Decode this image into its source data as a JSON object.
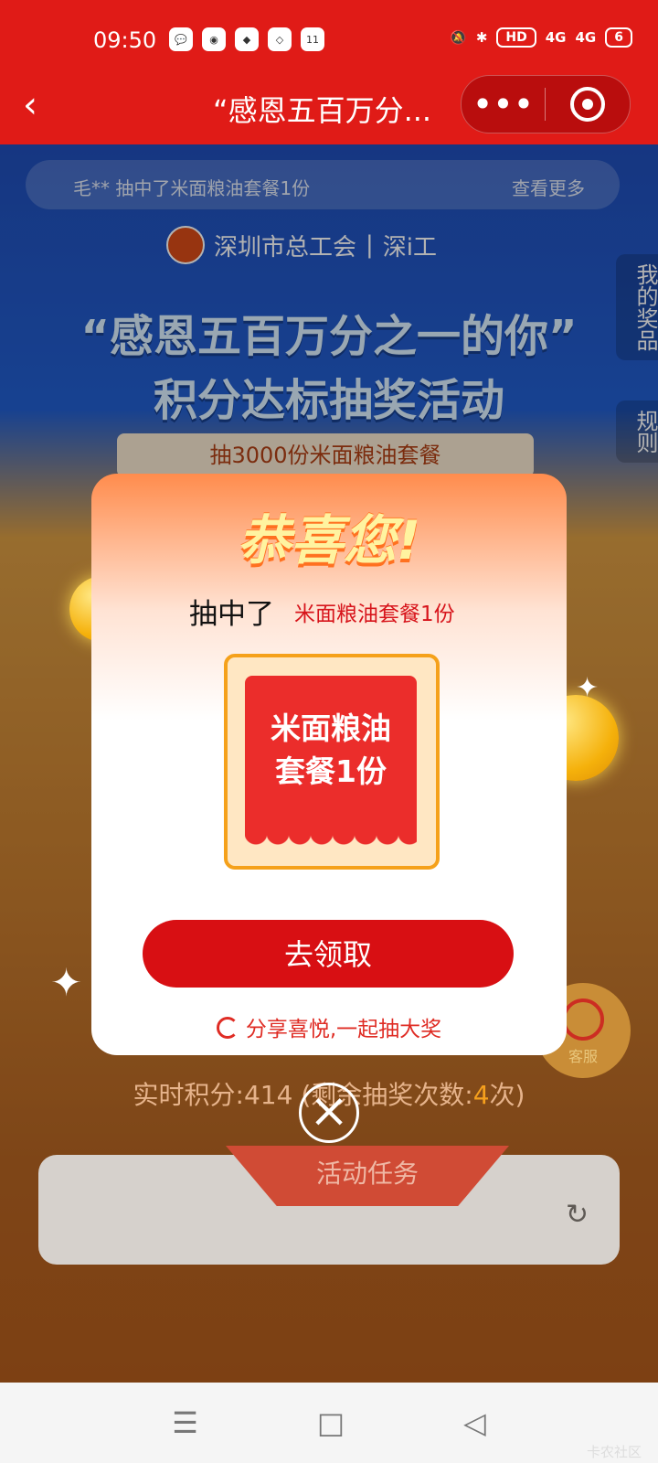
{
  "status": {
    "time": "09:50",
    "apps": [
      "💬",
      "◉",
      "◆",
      "◇",
      "11"
    ],
    "network": [
      "HD",
      "4G",
      "4G",
      "6"
    ]
  },
  "navbar": {
    "title": "“感恩五百万分...",
    "back_icon": "back-chevron",
    "more_icon": "more-dots",
    "target_icon": "target-circle"
  },
  "background": {
    "winner_text": "毛** 抽中了米面粮油套餐1份",
    "winner_more": "查看更多",
    "org_left": "深圳市总工会",
    "org_right": "深i工",
    "headline_1": "“感恩五百万分之一的你”",
    "headline_2": "积分达标抽奖活动",
    "prize_bar": "抽3000份米面粮油套餐",
    "side_tabs": [
      "我的奖品",
      "规则"
    ],
    "score_prefix": "实时积分:414 (剩余抽奖次数:",
    "score_count": "4",
    "score_suffix": "次)",
    "service": "客服",
    "task_title": "活动任务",
    "refresh_icon": "refresh-icon"
  },
  "modal": {
    "title": "恭喜您!",
    "drawn_label": "抽中了",
    "drawn_prize": "米面粮油套餐1份",
    "prize_lines": [
      "米面粮油",
      "套餐1份"
    ],
    "claim_button": "去领取",
    "share_text": "分享喜悦,一起抽大奖",
    "close_icon": "close-icon"
  },
  "system_nav": [
    "☰",
    "□",
    "◁"
  ],
  "watermark": "卡农社区",
  "colors": {
    "primary": "#E01B17",
    "gold": "#F5A11B",
    "button": "#D80F13"
  }
}
